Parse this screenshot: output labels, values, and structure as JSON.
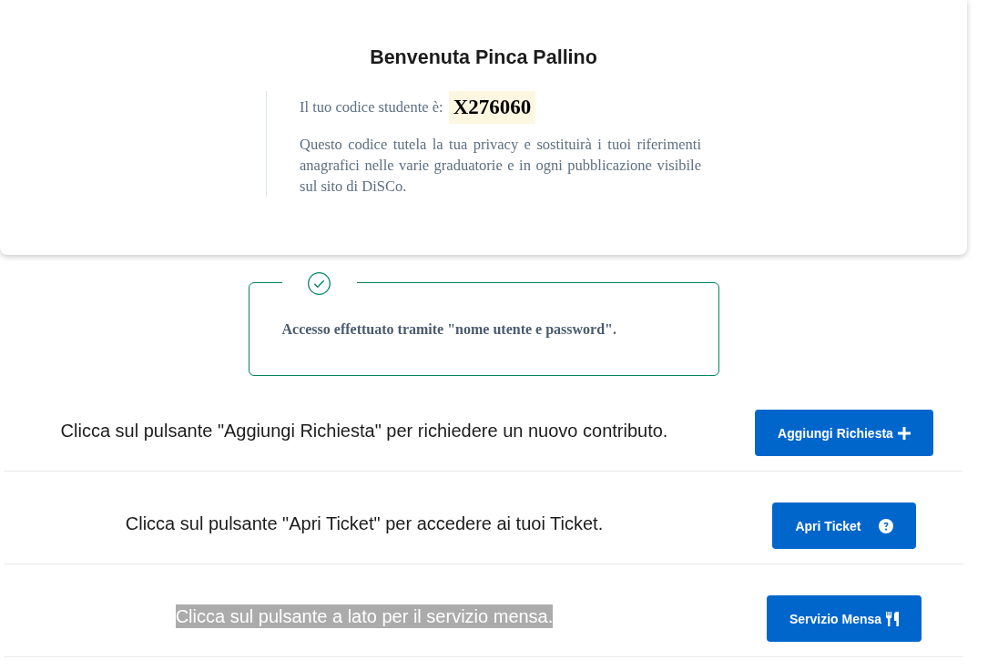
{
  "welcome": {
    "title": "Benvenuta Pinca Pallino",
    "code_label": "Il tuo codice studente è:",
    "code": "X276060",
    "description": "Questo codice tutela la tua privacy e sostituirà i tuoi riferimenti anagrafici nelle varie graduatorie e in ogni pubblicazione visibile sul sito di DiSCo."
  },
  "alert": {
    "kind": "success",
    "message": "Accesso effettuato tramite \"nome utente e password\"."
  },
  "actions": [
    {
      "text": "Clicca sul pulsante \"Aggiungi Richiesta\" per richiedere un nuovo contributo.",
      "highlighted": false,
      "button": "Aggiungi Richiesta"
    },
    {
      "text": "Clicca sul pulsante \"Apri Ticket\" per accedere ai tuoi Ticket.",
      "highlighted": false,
      "button": "Apri Ticket"
    },
    {
      "text": "Clicca sul pulsante a lato per il servizio mensa.",
      "highlighted": true,
      "button": "Servizio Mensa"
    }
  ]
}
